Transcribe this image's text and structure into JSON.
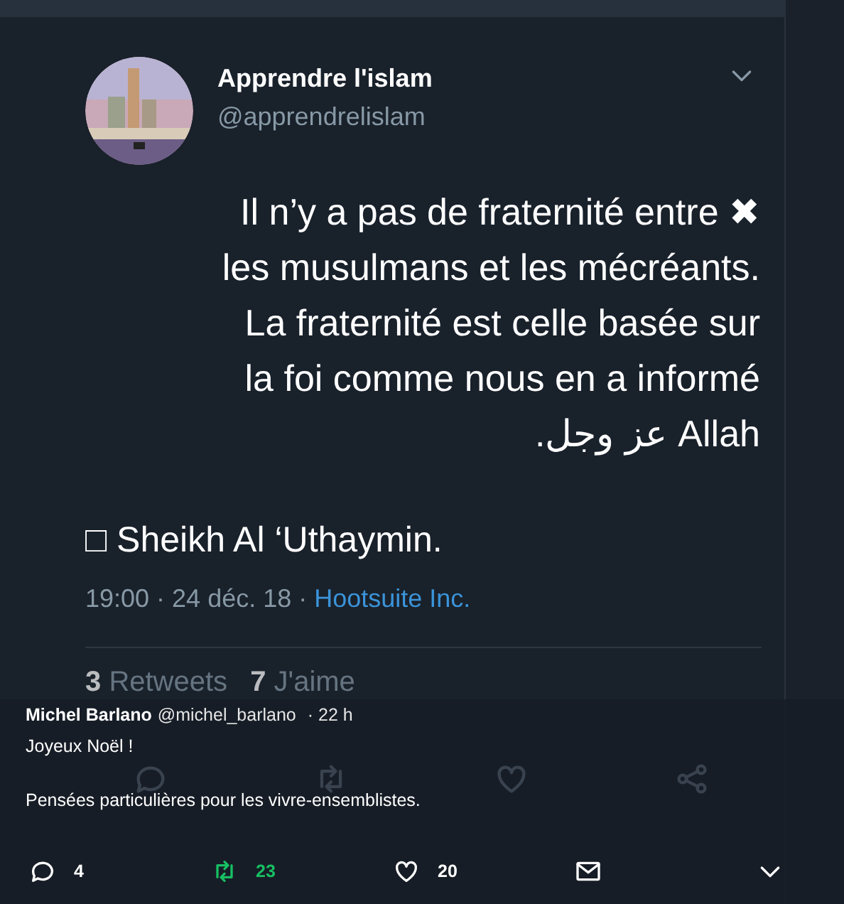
{
  "tweet": {
    "name": "Apprendre l'islam",
    "handle": "@apprendrelislam",
    "lines": [
      {
        "text": "Il n’y a pas de fraternité entre ✖",
        "kind": "ltr"
      },
      {
        "text": "les musulmans et les mécréants.",
        "kind": "ltr"
      },
      {
        "text": "La fraternité est celle basée sur",
        "kind": "ltr"
      },
      {
        "text": "la foi comme nous en a informé",
        "kind": "ltr"
      },
      {
        "text": "Allah عز وجل.",
        "kind": "rtl"
      }
    ],
    "signature": "□ Sheikh Al ‘Uthaymin.",
    "time": "19:00 · 24 déc. 18 ·",
    "source": "Hootsuite Inc.",
    "retweets_count": "3",
    "retweets_label": "Retweets",
    "likes_count": "7",
    "likes_label": "J'aime",
    "actions": [
      {
        "kind": "reply"
      },
      {
        "kind": "retweet"
      },
      {
        "kind": "like"
      },
      {
        "kind": "share"
      }
    ]
  },
  "reply": {
    "name": "Michel Barlano",
    "handle": "@michel_barlano",
    "time": "· 22 h",
    "paragraphs": [
      "Joyeux Noël !",
      "Pensées particulières pour les vivre-ensemblistes."
    ],
    "actions": [
      {
        "kind": "reply",
        "count": "4",
        "on": false
      },
      {
        "kind": "retweet",
        "count": "23",
        "on": true
      },
      {
        "kind": "like",
        "count": "20",
        "on": false
      },
      {
        "kind": "mail"
      },
      {
        "kind": "more"
      }
    ]
  }
}
